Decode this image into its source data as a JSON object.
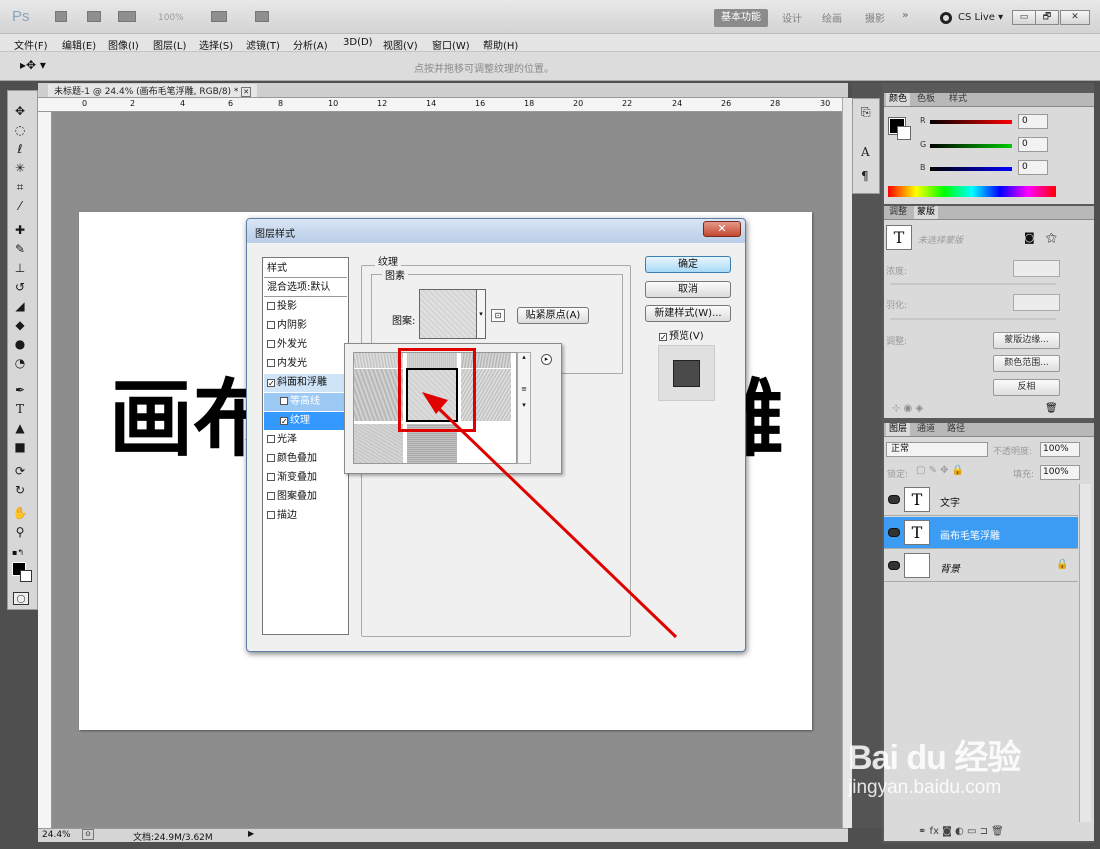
{
  "app": {
    "logo": "Ps",
    "zoom_dropdown": "100%",
    "workspaces": [
      "基本功能",
      "设计",
      "绘画",
      "摄影"
    ],
    "more_workspaces": "»",
    "cs_live": "CS Live ▾",
    "win_minimize": "▭",
    "win_restore": "🗗",
    "win_close": "✕"
  },
  "menubar": [
    "文件(F)",
    "编辑(E)",
    "图像(I)",
    "图层(L)",
    "选择(S)",
    "滤镜(T)",
    "分析(A)",
    "3D(D)",
    "视图(V)",
    "窗口(W)",
    "帮助(H)"
  ],
  "options_bar": {
    "tool_icon": "move-tool",
    "hint": "点按并拖移可调整纹理的位置。"
  },
  "document": {
    "tab_title": "未标题-1 @ 24.4% (画布毛笔浮雕, RGB/8) *",
    "tab_close": "✕",
    "canvas_text_left": "画布",
    "canvas_text_right": "雕",
    "ruler_top_labels": [
      "0",
      "2",
      "4",
      "6",
      "8",
      "10",
      "12",
      "14",
      "16",
      "18",
      "20",
      "22",
      "24",
      "26",
      "28",
      "30"
    ],
    "status_zoom": "24.4%",
    "status_doc": "文档:24.9M/3.62M"
  },
  "tools": [
    "move",
    "marquee",
    "lasso",
    "magic-wand",
    "crop",
    "eyedropper",
    "healing",
    "brush",
    "stamp",
    "history-brush",
    "eraser",
    "paint-bucket",
    "blur",
    "dodge",
    "pen",
    "type",
    "path-select",
    "shape",
    "3d-rotate",
    "3d-orbit",
    "hand",
    "zoom",
    "colors",
    "quick-mask"
  ],
  "dialog": {
    "title": "图层样式",
    "close": "✕",
    "style_list": {
      "header": "样式",
      "blend": "混合选项:默认",
      "items": [
        {
          "label": "投影",
          "checked": false,
          "selected": false,
          "sub": false
        },
        {
          "label": "内阴影",
          "checked": false,
          "selected": false,
          "sub": false
        },
        {
          "label": "外发光",
          "checked": false,
          "selected": false,
          "sub": false
        },
        {
          "label": "内发光",
          "checked": false,
          "selected": false,
          "sub": false
        },
        {
          "label": "斜面和浮雕",
          "checked": true,
          "selected": false,
          "sub": false
        },
        {
          "label": "等高线",
          "checked": false,
          "selected": true,
          "sub": true
        },
        {
          "label": "纹理",
          "checked": true,
          "selected": true,
          "sub": true
        },
        {
          "label": "光泽",
          "checked": false,
          "selected": false,
          "sub": false
        },
        {
          "label": "颜色叠加",
          "checked": false,
          "selected": false,
          "sub": false
        },
        {
          "label": "渐变叠加",
          "checked": false,
          "selected": false,
          "sub": false
        },
        {
          "label": "图案叠加",
          "checked": false,
          "selected": false,
          "sub": false
        },
        {
          "label": "描边",
          "checked": false,
          "selected": false,
          "sub": false
        }
      ]
    },
    "texture_legend": "纹理",
    "pattern_legend": "图素",
    "pattern_label": "图案:",
    "snap_button": "贴紧原点(A)",
    "ok_button": "确定",
    "cancel_button": "取消",
    "new_style_button": "新建样式(W)...",
    "preview_label": "预览(V)",
    "preview_checked": true
  },
  "right_panels": {
    "color_tabs": [
      "颜色",
      "色板",
      "样式"
    ],
    "color_channels": [
      {
        "label": "R",
        "value": "0",
        "color": "#ff0000"
      },
      {
        "label": "G",
        "value": "0",
        "color": "#00cc00"
      },
      {
        "label": "B",
        "value": "0",
        "color": "#0000ff"
      }
    ],
    "adjust_tabs": [
      "调整",
      "蒙版"
    ],
    "mask_title": "未选择蒙版",
    "mask_density": "浓度:",
    "mask_feather": "羽化:",
    "mask_refine": "调整:",
    "mask_buttons": [
      "蒙版边缘...",
      "颜色范围...",
      "反相"
    ],
    "layer_tabs": [
      "图层",
      "通道",
      "路径"
    ],
    "blend_mode": "正常",
    "opacity_label": "不透明度:",
    "opacity_value": "100%",
    "lock_label": "锁定:",
    "fill_label": "填充:",
    "fill_value": "100%",
    "layers": [
      {
        "name": "文字",
        "type": "text",
        "selected": false
      },
      {
        "name": "画布毛笔浮雕",
        "type": "text",
        "selected": true
      },
      {
        "name": "背景",
        "type": "background",
        "selected": false
      }
    ]
  },
  "watermark": {
    "brand": "Bai du 经验",
    "url": "jingyan.baidu.com"
  }
}
